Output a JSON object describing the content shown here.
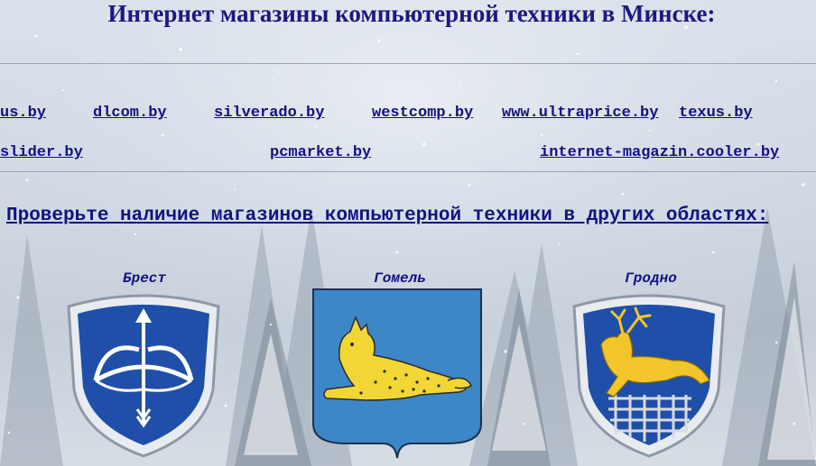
{
  "page": {
    "title": "Интернет магазины компьютерной техники в Минске:"
  },
  "minsk_links": {
    "row1": [
      "us.by",
      "dlcom.by",
      "silverado.by",
      "westcomp.by",
      "www.ultraprice.by",
      "texus.by"
    ],
    "row2": [
      "slider.by",
      "pcmarket.by",
      "internet-magazin.cooler.by"
    ]
  },
  "regions": {
    "heading": "Проверьте наличие магазинов компьютерной техники в других областях:",
    "items": [
      {
        "city": "Брест",
        "icon": "brest-coat-of-arms-icon"
      },
      {
        "city": "Гомель",
        "icon": "gomel-coat-of-arms-icon"
      },
      {
        "city": "Гродно",
        "icon": "grodno-coat-of-arms-icon"
      }
    ]
  },
  "colors": {
    "link": "#121280",
    "title": "#1a1a7e",
    "shield_blue": "#1f4fa8",
    "gomel_blue": "#3d86c7",
    "gold": "#f2d635"
  }
}
